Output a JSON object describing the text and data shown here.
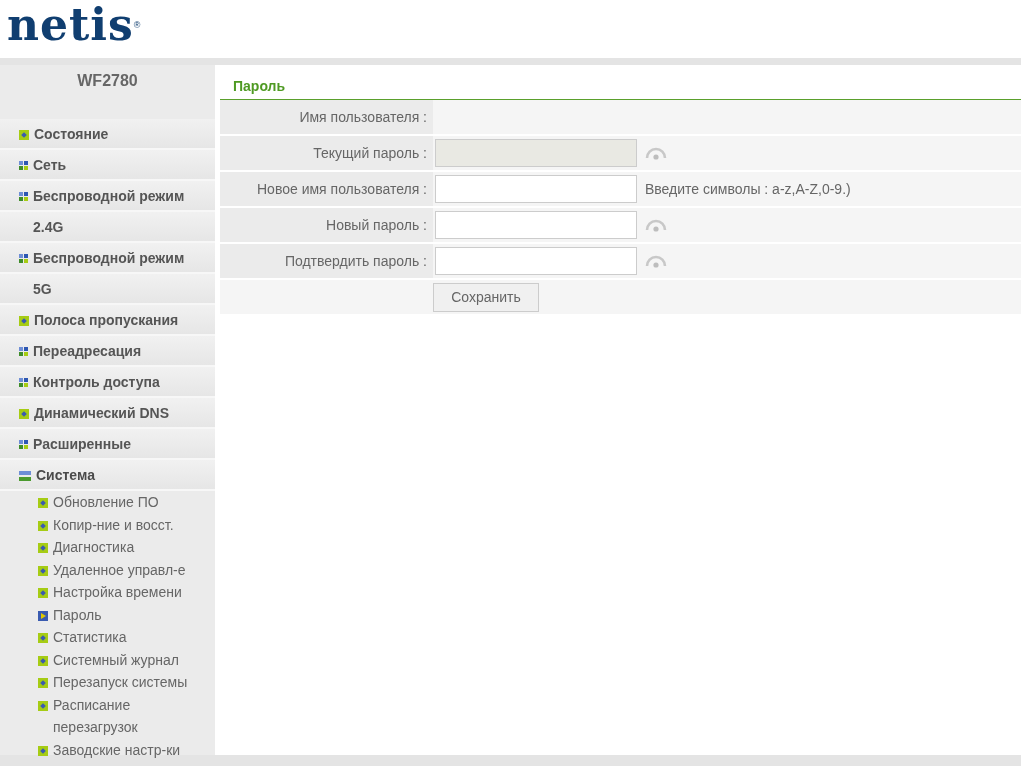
{
  "logo": {
    "text": "netis",
    "mark": "®"
  },
  "sidebar": {
    "model": "WF2780",
    "items": [
      {
        "label": "Состояние",
        "kind": "page"
      },
      {
        "label": "Сеть",
        "kind": "group",
        "expanded": false
      },
      {
        "label": "Беспроводной режим 2.4G",
        "kind": "group",
        "expanded": false
      },
      {
        "label": "Беспроводной режим 5G",
        "kind": "group",
        "expanded": false
      },
      {
        "label": "Полоса пропускания",
        "kind": "page"
      },
      {
        "label": "Переадресация",
        "kind": "group",
        "expanded": false
      },
      {
        "label": "Контроль доступа",
        "kind": "group",
        "expanded": false
      },
      {
        "label": "Динамический DNS",
        "kind": "page"
      },
      {
        "label": "Расширенные",
        "kind": "group",
        "expanded": false
      },
      {
        "label": "Система",
        "kind": "group",
        "expanded": true,
        "children": [
          {
            "label": "Обновление ПО",
            "selected": false
          },
          {
            "label": "Копир-ние и восст.",
            "selected": false
          },
          {
            "label": "Диагностика",
            "selected": false
          },
          {
            "label": "Удаленное управл-е",
            "selected": false
          },
          {
            "label": "Настройка времени",
            "selected": false
          },
          {
            "label": "Пароль",
            "selected": true
          },
          {
            "label": "Статистика",
            "selected": false
          },
          {
            "label": "Системный журнал",
            "selected": false
          },
          {
            "label": "Перезапуск системы",
            "selected": false
          },
          {
            "label": "Расписание перезагрузок",
            "selected": false
          },
          {
            "label": "Заводские настр-ки",
            "selected": false
          }
        ]
      }
    ]
  },
  "panel": {
    "title": "Пароль",
    "rows": [
      {
        "label": "Имя пользователя :",
        "kind": "static"
      },
      {
        "label": "Текущий пароль :",
        "kind": "input",
        "disabled": true,
        "eye": true
      },
      {
        "label": "Новое имя пользователя :",
        "kind": "input",
        "disabled": false,
        "eye": false,
        "hint": "Введите символы : a-z,A-Z,0-9.)"
      },
      {
        "label": "Новый пароль :",
        "kind": "input",
        "disabled": false,
        "eye": true
      },
      {
        "label": "Подтвердить пароль :",
        "kind": "input",
        "disabled": false,
        "eye": true
      }
    ],
    "button": "Сохранить"
  }
}
